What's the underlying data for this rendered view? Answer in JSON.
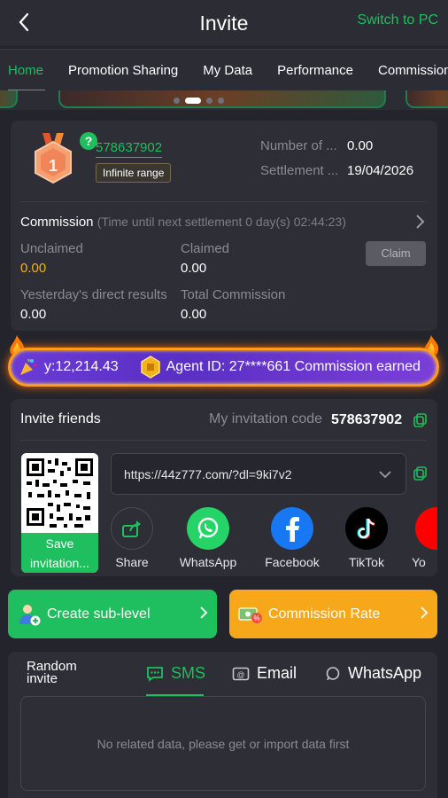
{
  "header": {
    "title": "Invite",
    "switch_label": "Switch to PC"
  },
  "tabs": [
    {
      "label": "Home"
    },
    {
      "label": "Promotion Sharing"
    },
    {
      "label": "My Data"
    },
    {
      "label": "Performance"
    },
    {
      "label": "Commission"
    }
  ],
  "banner": {
    "active_slide": 2,
    "slide_count": 5
  },
  "agent": {
    "level": "1",
    "id": "578637902",
    "range_badge": "Infinite range",
    "number_label": "Number of ...",
    "number_value": "0.00",
    "settlement_label": "Settlement ...",
    "settlement_value": "19/04/2026"
  },
  "commission": {
    "title": "Commission",
    "note": "(Time until next settlement 0 day(s) 02:44:23)",
    "unclaimed_label": "Unclaimed",
    "unclaimed_value": "0.00",
    "claimed_label": "Claimed",
    "claimed_value": "0.00",
    "claim_button": "Claim",
    "yesterday_label": "Yesterday's direct results",
    "yesterday_value": "0.00",
    "total_label": "Total Commission",
    "total_value": "0.00"
  },
  "marquee": {
    "amount_text": "y:12,214.43",
    "agent_text": "Agent ID: 27****661 Commission earned"
  },
  "invite": {
    "title": "Invite friends",
    "code_label": "My invitation code",
    "code_value": "578637902",
    "link": "https://44z777.com/?dl=9ki7v2",
    "qr_save_label": "Save invitation...",
    "share": [
      {
        "label": "Share",
        "icon": "share-icon"
      },
      {
        "label": "WhatsApp",
        "icon": "whatsapp-icon"
      },
      {
        "label": "Facebook",
        "icon": "facebook-icon"
      },
      {
        "label": "TikTok",
        "icon": "tiktok-icon"
      },
      {
        "label": "Yo",
        "icon": "youtube-icon"
      }
    ]
  },
  "actions": {
    "create_sub": "Create sub-level",
    "commission_rate": "Commission Rate"
  },
  "random_invite": {
    "title": "Random invite",
    "tabs": [
      {
        "label": "SMS",
        "icon": "sms-icon"
      },
      {
        "label": "Email",
        "icon": "email-icon"
      },
      {
        "label": "WhatsApp",
        "icon": "whatsapp-icon"
      }
    ],
    "empty_text": "No related data, please get or import data first"
  },
  "colors": {
    "accent": "#1fbe5e",
    "orange": "#f7a81a",
    "unclaimed": "#f2b318",
    "background": "#24252c",
    "card": "#2d2e36"
  }
}
